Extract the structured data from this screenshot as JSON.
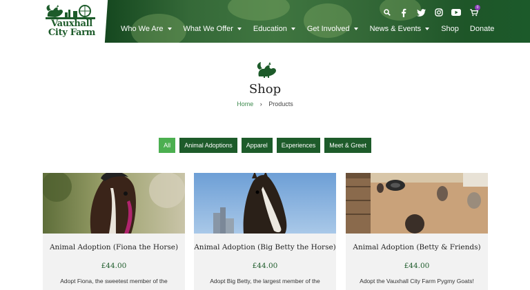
{
  "brand": {
    "logo_line1": "Vauxhall",
    "logo_line2": "City Farm"
  },
  "header": {
    "icons": [
      "search-icon",
      "facebook-icon",
      "twitter-icon",
      "instagram-icon",
      "youtube-icon",
      "cart-icon"
    ],
    "cart_count": "0",
    "nav": [
      {
        "label": "Who We Are",
        "dropdown": true
      },
      {
        "label": "What We Offer",
        "dropdown": true
      },
      {
        "label": "Education",
        "dropdown": true
      },
      {
        "label": "Get Involved",
        "dropdown": true
      },
      {
        "label": "News & Events",
        "dropdown": true
      },
      {
        "label": "Shop",
        "dropdown": false
      },
      {
        "label": "Donate",
        "dropdown": false
      }
    ]
  },
  "page": {
    "title": "Shop",
    "breadcrumb": {
      "home": "Home",
      "current": "Products"
    }
  },
  "filters": [
    {
      "label": "All",
      "active": true
    },
    {
      "label": "Animal Adoptions",
      "active": false
    },
    {
      "label": "Apparel",
      "active": false
    },
    {
      "label": "Experiences",
      "active": false
    },
    {
      "label": "Meet & Greet",
      "active": false
    }
  ],
  "products": [
    {
      "title": "Animal Adoption (Fiona the Horse)",
      "price": "£44.00",
      "description": "Adopt Fiona, the sweetest member of the"
    },
    {
      "title": "Animal Adoption (Big Betty the Horse)",
      "price": "£44.00",
      "description": "Adopt Big Betty, the largest member of the"
    },
    {
      "title": "Animal Adoption (Betty & Friends)",
      "price": "£44.00",
      "description": "Adopt the Vauxhall City Farm Pygmy Goats!"
    }
  ],
  "colors": {
    "brand_green": "#1d5b2a",
    "active_filter": "#4caf50",
    "link_green": "#3e8a4e",
    "card_bg": "#f2f2f2"
  }
}
